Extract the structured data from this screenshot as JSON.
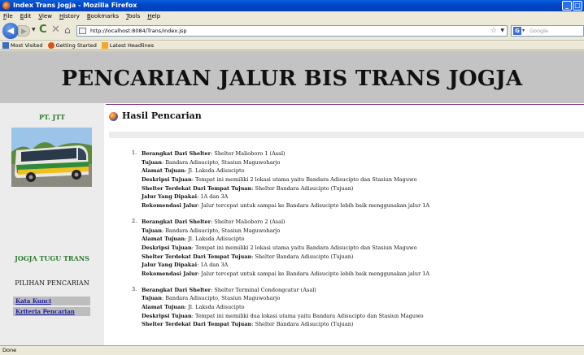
{
  "window": {
    "title": "Index Trans Jogja - Mozilla Firefox"
  },
  "menu": [
    "File",
    "Edit",
    "View",
    "History",
    "Bookmarks",
    "Tools",
    "Help"
  ],
  "nav": {
    "url": "http://localhost:8084/Trans/index.jsp",
    "search_placeholder": "Google"
  },
  "bookmarks": [
    "Most Visited",
    "Getting Started",
    "Latest Headlines"
  ],
  "page": {
    "banner_title": "PENCARIAN JALUR BIS TRANS JOGJA",
    "sidebar": {
      "company": "PT. JTT",
      "brand": "JOGJA TUGU TRANS",
      "menu_title": "PILIHAN PENCARIAN",
      "links": [
        "Kata Kunci",
        "Kriteria Pencarian"
      ]
    },
    "heading": "Hasil Pencarian",
    "results": [
      {
        "num": "1.",
        "berangkat_label": "Berangkat Dari Shelter",
        "berangkat": ": Shelter Malioboro 1 (Asal)",
        "tujuan_label": "Tujuan",
        "tujuan": ": Bandara Adisucipto, Stasiun Maguwoharjo",
        "alamat_label": "Alamat Tujuan",
        "alamat": ": Jl. Laksda Adisucipto",
        "deskripsi_label": "Deskripsi Tujuan",
        "deskripsi": ": Tempat ini memiliki 2 lokasi utama yaitu Bandara Adisucipto dan Stasiun Maguwo",
        "shelter_label": "Shelter Terdekat Dari Tempat Tujuan",
        "shelter": ": Shelter Bandara Adisucipto (Tujuan)",
        "jalur_label": "Jalur Yang Dipakai",
        "jalur": ": 1A dan 3A",
        "rekomendasi_label": "Rekomendasi Jalur",
        "rekomendasi": ": Jalur tercepat untuk sampai ke Bandara Adisucipto lebih baik menggunakan jalur 1A"
      },
      {
        "num": "2.",
        "berangkat_label": "Berangkat Dari Shelter",
        "berangkat": ": Shelter Malioboro 2 (Asal)",
        "tujuan_label": "Tujuan",
        "tujuan": ": Bandara Adisucipto, Stasiun Maguwoharjo",
        "alamat_label": "Alamat Tujuan",
        "alamat": ": Jl. Laksda Adisucipto",
        "deskripsi_label": "Deskripsi Tujuan",
        "deskripsi": ": Tempat ini memiliki 2 lokasi utama yaitu Bandara Adisucipto dan Stasiun Maguwo",
        "shelter_label": "Shelter Terdekat Dari Tempat Tujuan",
        "shelter": ": Shelter Bandara Adisucipto (Tujuan)",
        "jalur_label": "Jalur Yang Dipakai",
        "jalur": ": 1A dan 3A",
        "rekomendasi_label": "Rekomendasi Jalur",
        "rekomendasi": ": Jalur tercepat untuk sampai ke Bandara Adisucipto lebih baik menggunakan jalur 1A"
      },
      {
        "num": "3.",
        "berangkat_label": "Berangkat Dari Shelter",
        "berangkat": ": Shelter Terminal Condongcatur (Asal)",
        "tujuan_label": "Tujuan",
        "tujuan": ": Bandara Adisucipto, Stasiun Maguwoharjo",
        "alamat_label": "Alamat Tujuan",
        "alamat": ": Jl. Laksda Adisucipto",
        "deskripsi_label": "Deskripsi Tujuan",
        "deskripsi": ": Tempat ini memiliki dua lokasi utama yaitu Bandara Adisucipto dan Stasiun Maguwo",
        "shelter_label": "Shelter Terdekat Dari Tempat Tujuan",
        "shelter": ": Shelter Bandara Adisucipto (Tujuan)"
      }
    ]
  },
  "status": "Done"
}
